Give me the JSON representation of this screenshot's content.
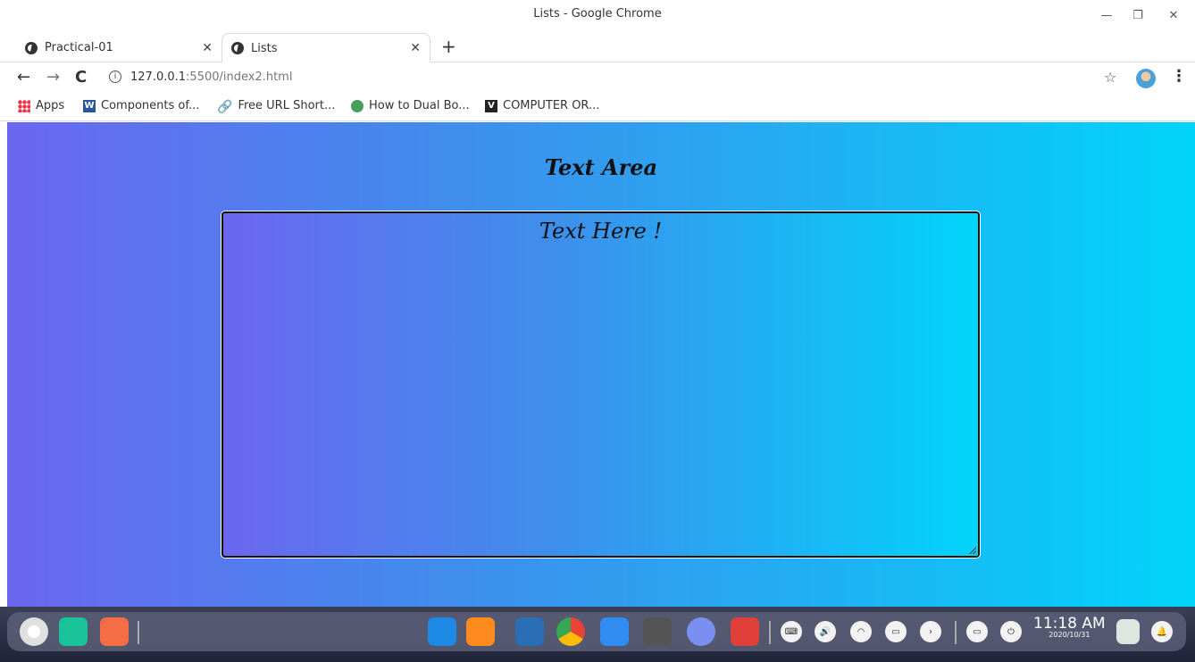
{
  "window": {
    "title": "Lists - Google Chrome"
  },
  "tabs": [
    {
      "label": "Practical-01"
    },
    {
      "label": "Lists"
    }
  ],
  "toolbar": {
    "url_host": "127.0.0.1",
    "url_path": ":5500/index2.html"
  },
  "bookmarks": [
    {
      "label": "Apps",
      "icon": "apps-grid-icon"
    },
    {
      "label": "Components of...",
      "icon": "word-icon"
    },
    {
      "label": "Free URL Short...",
      "icon": "link-icon"
    },
    {
      "label": "How to Dual Bo...",
      "icon": "dualboot-icon"
    },
    {
      "label": "COMPUTER OR...",
      "icon": "v-icon"
    }
  ],
  "page": {
    "heading": "Text Area",
    "textarea_placeholder": "Text Here !",
    "gradient": [
      "#6b67f0",
      "#00d4fb"
    ]
  },
  "taskbar": {
    "time": "11:18 AM",
    "date": "2020/10/31"
  }
}
